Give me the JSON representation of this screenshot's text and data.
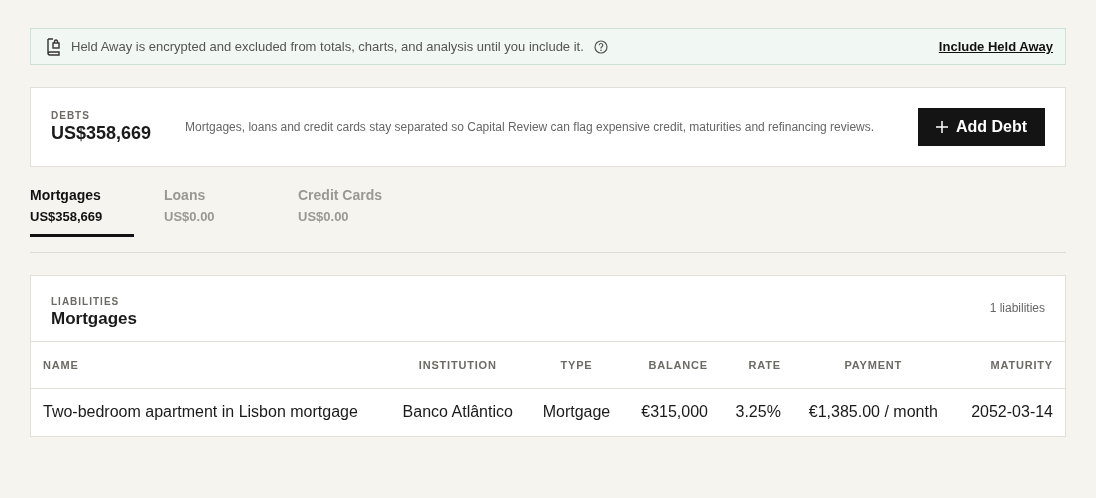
{
  "notice": {
    "text": "Held Away is encrypted and excluded from totals, charts, and analysis until you include it.",
    "link": "Include Held Away"
  },
  "summary": {
    "label": "DEBTS",
    "total": "US$358,669",
    "description": "Mortgages, loans and credit cards stay separated so Capital Review can flag expensive credit, maturities and refinancing reviews.",
    "button": "Add Debt"
  },
  "tabs": [
    {
      "label": "Mortgages",
      "amount": "US$358,669",
      "selected": true
    },
    {
      "label": "Loans",
      "amount": "US$0.00",
      "selected": false
    },
    {
      "label": "Credit Cards",
      "amount": "US$0.00",
      "selected": false
    }
  ],
  "table": {
    "eyebrow": "LIABILITIES",
    "title": "Mortgages",
    "count": "1 liabilities",
    "columns": [
      "NAME",
      "INSTITUTION",
      "TYPE",
      "BALANCE",
      "RATE",
      "PAYMENT",
      "MATURITY"
    ],
    "rows": [
      [
        "Two-bedroom apartment in Lisbon mortgage",
        "Banco Atlântico",
        "Mortgage",
        "€315,000",
        "3.25%",
        "€1,385.00 / month",
        "2052-03-14"
      ]
    ]
  }
}
